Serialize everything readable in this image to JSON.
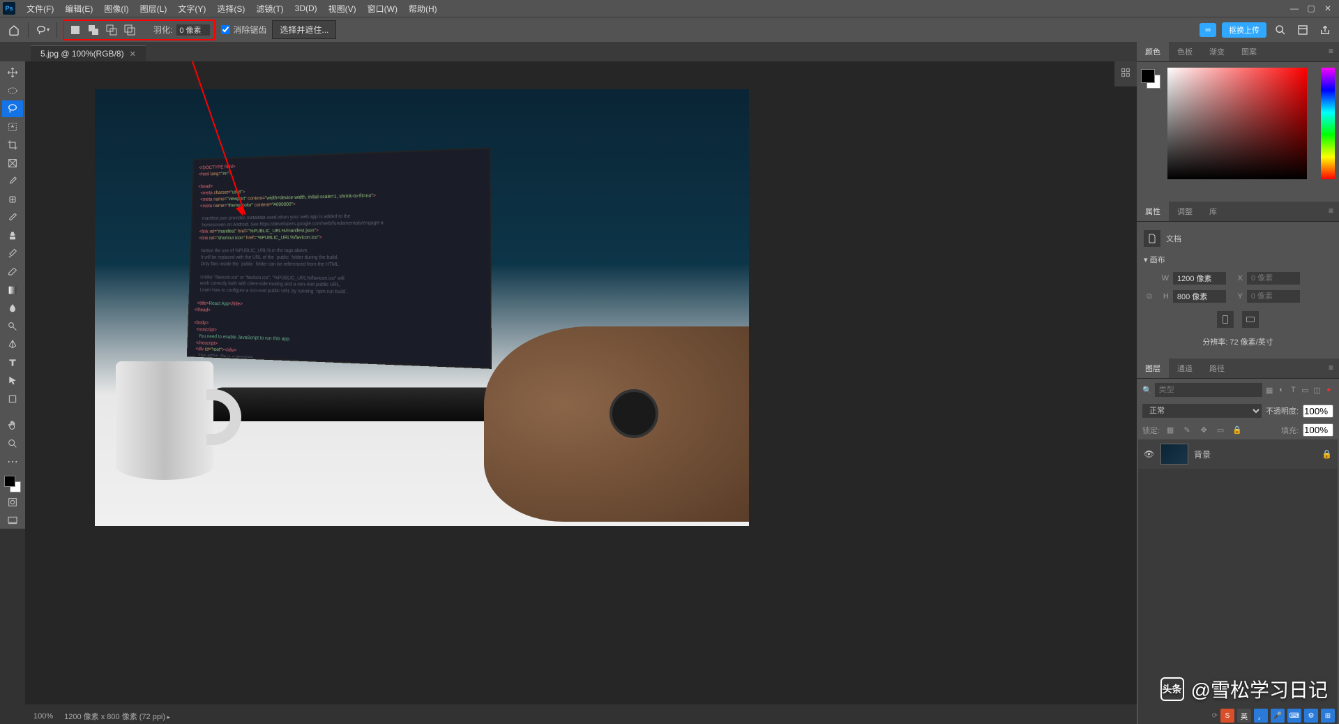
{
  "menubar": {
    "items": [
      "文件(F)",
      "编辑(E)",
      "图像(I)",
      "图层(L)",
      "文字(Y)",
      "选择(S)",
      "滤镜(T)",
      "3D(D)",
      "视图(V)",
      "窗口(W)",
      "帮助(H)"
    ]
  },
  "optbar": {
    "feather_label": "羽化:",
    "feather_value": "0 像素",
    "antialias": "消除锯齿",
    "select_mask": "选择并遮住...",
    "upload": "抠换上传"
  },
  "doctab": {
    "title": "5.jpg @ 100%(RGB/8)"
  },
  "panels": {
    "color_tabs": [
      "颜色",
      "色板",
      "渐变",
      "图案"
    ],
    "props_tabs": [
      "属性",
      "调整",
      "库"
    ],
    "layers_tabs": [
      "图层",
      "通道",
      "路径"
    ]
  },
  "props": {
    "doc_label": "文档",
    "canvas_label": "画布",
    "w_label": "W",
    "w_value": "1200 像素",
    "h_label": "H",
    "h_value": "800 像素",
    "x_label": "X",
    "x_placeholder": "0 像素",
    "y_label": "Y",
    "y_placeholder": "0 像素",
    "resolution": "分辨率: 72 像素/英寸"
  },
  "layers": {
    "kind_placeholder": "类型",
    "blend_mode": "正常",
    "opacity_label": "不透明度:",
    "opacity_value": "100%",
    "lock_label": "锁定:",
    "fill_label": "填充:",
    "fill_value": "100%",
    "layer_name": "背景"
  },
  "statusbar": {
    "zoom": "100%",
    "docinfo": "1200 像素 x 800 像素 (72 ppi)"
  },
  "watermark": {
    "logo": "头条",
    "text": "@雪松学习日记"
  },
  "ime": {
    "s": "S",
    "lang": "英"
  }
}
